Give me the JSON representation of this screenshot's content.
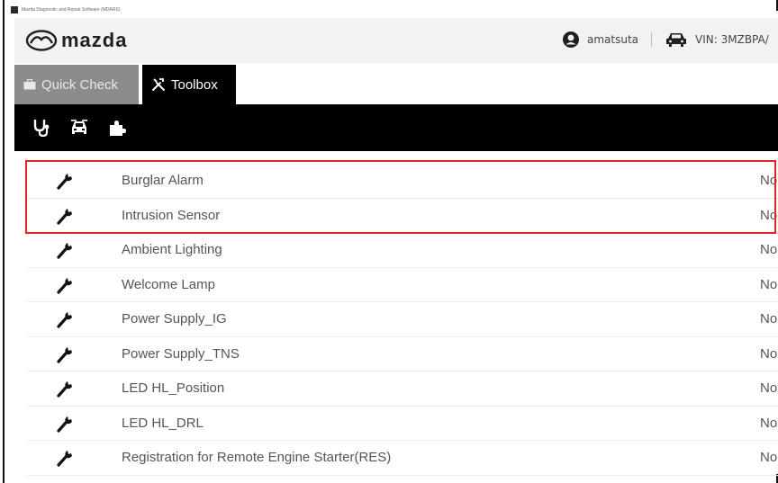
{
  "window": {
    "title": "Mazda Diagnostic and Repair Software (MDARS)"
  },
  "header": {
    "brand": "mazda",
    "user": {
      "icon": "user-circle-icon",
      "name": "amatsuta"
    },
    "vehicle": {
      "icon": "car-icon",
      "vin_label": "VIN: 3MZBPA/"
    }
  },
  "tabs": [
    {
      "label": "Quick Check",
      "icon": "briefcase-icon",
      "active": false
    },
    {
      "label": "Toolbox",
      "icon": "tools-icon",
      "active": true
    }
  ],
  "toolbar": {
    "icons": [
      "stethoscope-icon",
      "car-front-icon",
      "puzzle-icon"
    ]
  },
  "functions": [
    {
      "label": "Burglar Alarm",
      "status": "No"
    },
    {
      "label": "Intrusion Sensor",
      "status": "No"
    },
    {
      "label": "Ambient Lighting",
      "status": "No"
    },
    {
      "label": "Welcome Lamp",
      "status": "No"
    },
    {
      "label": "Power Supply_IG",
      "status": "No"
    },
    {
      "label": "Power Supply_TNS",
      "status": "No"
    },
    {
      "label": "LED HL_Position",
      "status": "No"
    },
    {
      "label": "LED HL_DRL",
      "status": "No"
    },
    {
      "label": "Registration for Remote Engine Starter(RES)",
      "status": "No"
    }
  ],
  "colors": {
    "header_bg": "#f2f2f2",
    "tab_inactive": "#8c8c8c",
    "tab_active": "#000000",
    "highlight": "#e0242b"
  }
}
